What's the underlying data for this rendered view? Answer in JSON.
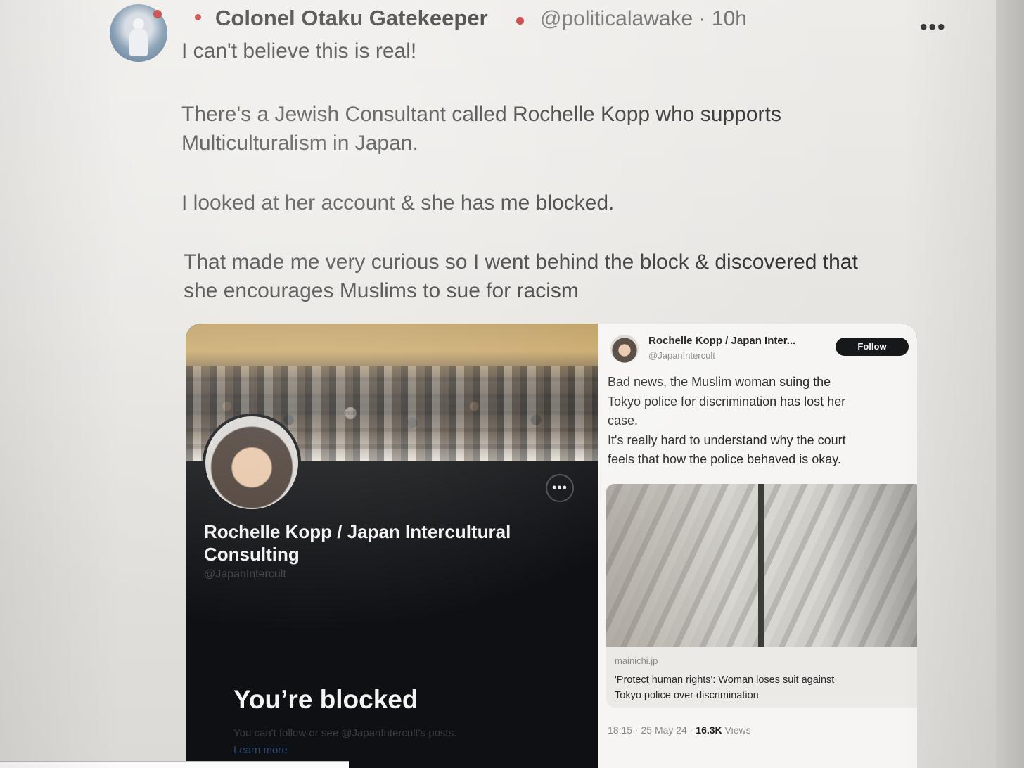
{
  "post": {
    "author_name": "Colonel Otaku Gatekeeper",
    "handle_time": "@politicalawake · 10h",
    "more_label": "•••",
    "paragraphs": [
      "I can't believe this is real!",
      "There's a Jewish Consultant called Rochelle Kopp who supports\nMulticulturalism in Japan.",
      " I looked at her account & she has me blocked.",
      "That made me very curious so I went behind the block & discovered that\nshe encourages Muslims to sue for racism"
    ]
  },
  "blocked_profile": {
    "more_label": "•••",
    "name": "Rochelle Kopp / Japan Intercultural Consulting",
    "handle": "@JapanIntercult",
    "title": "You’re blocked",
    "subtitle": "You can't follow or see @JapanIntercult's posts.",
    "learn_more": "Learn more"
  },
  "embedded_tweet": {
    "name": "Rochelle Kopp / Japan Inter...",
    "handle": "@JapanIntercult",
    "follow_label": "Follow",
    "text_lines": [
      "Bad news, the Muslim woman suing the",
      "Tokyo police for discrimination has lost her",
      "case.",
      "It's really hard to understand why the court",
      "feels that how the police behaved is okay."
    ],
    "card": {
      "domain": "mainichi.jp",
      "title_lines": [
        "'Protect human rights': Woman loses suit against",
        "Tokyo police over discrimination"
      ]
    },
    "meta": {
      "time_date": "18:15 · 25 May 24 · ",
      "views_count": "16.3K",
      "views_label": " Views"
    }
  },
  "colors": {
    "red_dot": "#c02a2a",
    "dark_panel": "#0f1013",
    "follow_button": "#17181a"
  }
}
